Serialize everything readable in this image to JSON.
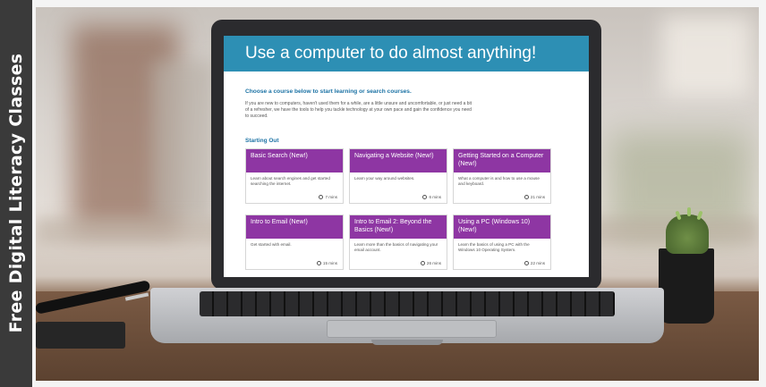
{
  "banner": {
    "side_text": "Free Digital Literacy Classes"
  },
  "screen": {
    "title": "Use a computer to do almost anything!",
    "subtitle": "Choose a course below to start learning or search courses.",
    "intro": "If you are new to computers, haven't used them for a while, are a little unsure and uncomfortable, or just need a bit of a refresher, we have the tools to help you tackle technology at your own pace and gain the confidence you need to succeed.",
    "section_title": "Starting Out",
    "courses": [
      {
        "title": "Basic Search (New!)",
        "description": "Learn about search engines and get started searching the internet.",
        "time": "7 mins"
      },
      {
        "title": "Navigating a Website (New!)",
        "description": "Learn your way around websites.",
        "time": "6 mins"
      },
      {
        "title": "Getting Started on a Computer (New!)",
        "description": "What a computer is and how to use a mouse and keyboard.",
        "time": "21 mins"
      },
      {
        "title": "Intro to Email (New!)",
        "description": "Get started with email.",
        "time": "15 mins"
      },
      {
        "title": "Intro to Email 2: Beyond the Basics (New!)",
        "description": "Learn more than the basics of navigating your email account.",
        "time": "26 mins"
      },
      {
        "title": "Using a PC (Windows 10) (New!)",
        "description": "Learn the basics of using a PC with the Windows 10 Operating System.",
        "time": "22 mins"
      }
    ]
  },
  "colors": {
    "header": "#2d8fb4",
    "card_header": "#8e36a3",
    "link_text": "#1d73a5",
    "sidebar": "#3a3a3a"
  }
}
